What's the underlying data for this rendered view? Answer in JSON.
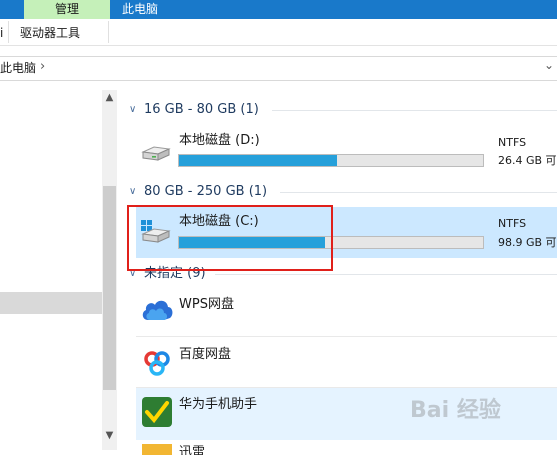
{
  "ribbon": {
    "tab_manage": "管理",
    "tab_this_pc": "此电脑",
    "left_cut": "i",
    "drive_tools": "驱动器工具"
  },
  "address": {
    "text": "此电脑"
  },
  "groups": [
    {
      "label": "16 GB - 80 GB (1)",
      "drives": [
        {
          "name": "本地磁盘 (D:)",
          "fs": "NTFS",
          "free": "26.4 GB 可",
          "usage": 0.52
        }
      ]
    },
    {
      "label": "80 GB - 250 GB (1)",
      "drives": [
        {
          "name": "本地磁盘 (C:)",
          "fs": "NTFS",
          "free": "98.9 GB 可",
          "usage": 0.48
        }
      ]
    },
    {
      "label": "未指定 (9)",
      "items": [
        "WPS网盘",
        "百度网盘",
        "华为手机助手",
        "迅雷"
      ]
    }
  ],
  "watermark": "Bai 经验",
  "colors": {
    "accent": "#1979ca",
    "manage_tab": "#c5f0b9",
    "bar": "#26a0da",
    "selection": "#cce8ff",
    "highlight": "#e0201a"
  }
}
